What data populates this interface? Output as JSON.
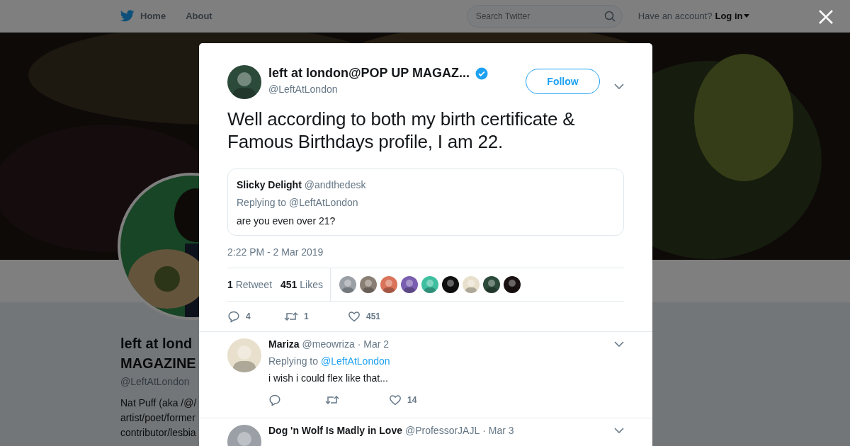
{
  "top_bar": {
    "nav": [
      {
        "label": "Home"
      },
      {
        "label": "About"
      }
    ],
    "search": {
      "placeholder": "Search Twitter"
    },
    "account_prompt": "Have an account?",
    "login": "Log in"
  },
  "profile": {
    "name_lines": [
      "left at lond",
      "MAGAZINE"
    ],
    "handle": "@LeftAtLondon",
    "bio_lines": [
      "Nat Puff (aka /@/",
      "artist/poet/former",
      "contributor/lesbia"
    ]
  },
  "tweet": {
    "author": {
      "name": "left at london@POP UP MAGAZ...",
      "handle": "@LeftAtLondon",
      "verified": true
    },
    "follow_label": "Follow",
    "text": "Well according to both my birth certificate & Famous Birthdays profile, I am 22.",
    "quoted": {
      "name": "Slicky Delight",
      "handle": "@andthedesk",
      "replying_prefix": "Replying to",
      "replying_to": "@LeftAtLondon",
      "text": "are you even over 21?"
    },
    "time": "2:22 PM - 2 Mar 2019",
    "stats": [
      {
        "count": "1",
        "label": "Retweet"
      },
      {
        "count": "451",
        "label": "Likes"
      }
    ],
    "actions": {
      "reply": "4",
      "retweet": "1",
      "like": "451"
    }
  },
  "replies": [
    {
      "name": "Mariza",
      "handle": "@meowriza",
      "date": "· Mar 2",
      "replying_prefix": "Replying to",
      "replying_to": "@LeftAtLondon",
      "text": "i wish i could flex like that...",
      "actions": {
        "like": "14"
      }
    },
    {
      "name": "Dog 'n Wolf Is Madly in Love",
      "handle": "@ProfessorJAJL",
      "date": "· Mar 3"
    }
  ]
}
